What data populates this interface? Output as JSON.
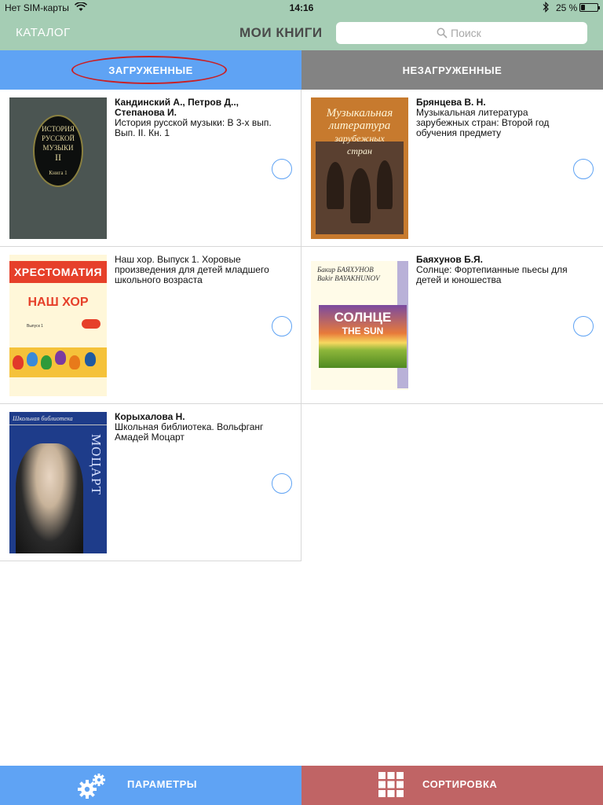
{
  "status_bar": {
    "carrier": "Нет SIM-карты",
    "time": "14:16",
    "battery": "25 %",
    "battery_level": 0.25
  },
  "navbar": {
    "catalog_label": "КАТАЛОГ",
    "title": "МОИ КНИГИ",
    "search_placeholder": "Поиск"
  },
  "tabs": [
    {
      "label": "ЗАГРУЖЕННЫЕ",
      "active": true
    },
    {
      "label": "НЕЗАГРУЖЕННЫЕ",
      "active": false
    }
  ],
  "books": [
    {
      "author": "Кандинский А., Петров Д.., Степанова И.",
      "title": "История русской музыки: В 3-х вып. Вып. II. Кн. 1",
      "cover_text": [
        "ИСТОРИЯ",
        "РУССКОЙ",
        "МУЗЫКИ",
        "II"
      ],
      "cover_subtext": "Книга 1"
    },
    {
      "author": "Брянцева В. Н.",
      "title": "Музыкальная литература зарубежных стран: Второй год обучения предмету",
      "cover_text": [
        "Музыкальная",
        "литература",
        "зарубежных",
        "стран"
      ]
    },
    {
      "author": "",
      "title": "Наш хор. Выпуск 1. Хоровые произведения для детей младшего школьного возраста",
      "cover_text": [
        "ХРЕСТОМАТИЯ",
        "НАШ ХОР"
      ],
      "cover_subtext": "Выпуск 1"
    },
    {
      "author": "Баяхунов Б.Я.",
      "title": "Солнце: Фортепианные пьесы для детей и юношества",
      "cover_text": [
        "Бакир БАЯХУНОВ",
        "Bakir BAYAKHUNOV",
        "СОЛНЦЕ",
        "THE SUN"
      ]
    },
    {
      "author": "Корыхалова Н.",
      "title": "Школьная библиотека. Вольфганг Амадей Моцарт",
      "cover_text": [
        "Школьная библиотека",
        "МОЦАРТ"
      ]
    }
  ],
  "bottom_bar": {
    "params_label": "ПАРАМЕТРЫ",
    "sort_label": "СОРТИРОВКА"
  }
}
